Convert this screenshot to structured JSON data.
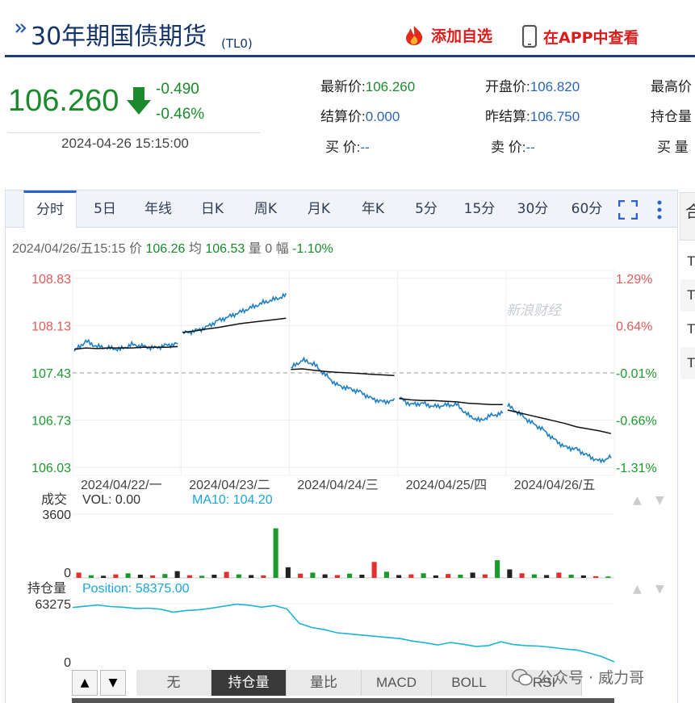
{
  "header": {
    "title": "30年期国债期货",
    "code": "(TL0)",
    "add_watchlist": "添加自选",
    "open_in_app": "在APP中查看"
  },
  "quote": {
    "price": "106.260",
    "change": "-0.490",
    "change_pct": "-0.46%",
    "time": "2024-04-26 15:15:00",
    "fields": {
      "latest": {
        "label": "最新价:",
        "value": "106.260"
      },
      "open": {
        "label": "开盘价:",
        "value": "106.820"
      },
      "high": {
        "label": "最高价"
      },
      "settle": {
        "label": "结算价:",
        "value": "0.000"
      },
      "prev_settle": {
        "label": "昨结算:",
        "value": "106.750"
      },
      "open_interest": {
        "label": "持仓量"
      },
      "bid": {
        "label": "买  价:",
        "value": "--"
      },
      "ask": {
        "label": "卖  价:",
        "value": "--"
      },
      "bid_vol": {
        "label": "买  量"
      }
    },
    "colors": {
      "down": "#1b8a2c",
      "up": "#e03030",
      "link": "#2a66b5"
    }
  },
  "tabs": [
    "分时",
    "5日",
    "年线",
    "日K",
    "周K",
    "月K",
    "年K",
    "5分",
    "15分",
    "30分",
    "60分"
  ],
  "infobar": {
    "datetime": "2024/04/26/五15:15",
    "price_label": "价",
    "price": "106.26",
    "avg_label": "均",
    "avg": "106.53",
    "vol_label": "量",
    "vol": "0",
    "amp_label": "幅",
    "amp": "-1.10%"
  },
  "chart_data": [
    {
      "type": "line",
      "title": "",
      "x": [
        "2024/04/22/一",
        "2024/04/23/二",
        "2024/04/24/三",
        "2024/04/25/四",
        "2024/04/26/五"
      ],
      "y_ticks_left": [
        "108.83",
        "108.13",
        "107.43",
        "106.73",
        "106.03"
      ],
      "y_ticks_right": [
        "1.29%",
        "0.64%",
        "-0.01%",
        "-0.66%",
        "-1.31%"
      ],
      "ylim": [
        106.03,
        108.83
      ],
      "prev_settle_line": 107.43,
      "watermark": "新浪财经",
      "series": [
        {
          "name": "价",
          "segments": [
            [
              107.75,
              107.9,
              107.82,
              107.8,
              107.78,
              107.85,
              107.82,
              107.8,
              107.84,
              107.86
            ],
            [
              108.02,
              108.05,
              108.1,
              108.2,
              108.26,
              108.33,
              108.4,
              108.47,
              108.52,
              108.58
            ],
            [
              107.5,
              107.62,
              107.56,
              107.4,
              107.25,
              107.2,
              107.15,
              107.05,
              107.0,
              107.02
            ],
            [
              107.06,
              106.96,
              106.98,
              106.93,
              106.95,
              106.96,
              106.8,
              106.72,
              106.8,
              106.83
            ],
            [
              106.95,
              106.83,
              106.7,
              106.6,
              106.45,
              106.33,
              106.3,
              106.2,
              106.12,
              106.18
            ]
          ]
        },
        {
          "name": "均",
          "segments": [
            [
              107.78,
              107.8,
              107.79,
              107.8,
              107.8,
              107.8,
              107.81,
              107.81,
              107.81,
              107.82
            ],
            [
              108.03,
              108.05,
              108.08,
              108.1,
              108.13,
              108.16,
              108.18,
              108.2,
              108.22,
              108.24
            ],
            [
              107.48,
              107.49,
              107.47,
              107.45,
              107.44,
              107.43,
              107.42,
              107.41,
              107.4,
              107.39
            ],
            [
              107.05,
              107.03,
              107.02,
              107.02,
              107.01,
              107.0,
              106.98,
              106.97,
              106.96,
              106.96
            ],
            [
              106.88,
              106.84,
              106.8,
              106.76,
              106.72,
              106.68,
              106.63,
              106.6,
              106.57,
              106.53
            ]
          ]
        }
      ]
    },
    {
      "type": "bar",
      "title": "成交",
      "legend": [
        "VOL: 0.00",
        "MA10: 104.20"
      ],
      "y_ticks": [
        "3600",
        "0"
      ],
      "ylim": [
        0,
        3600
      ],
      "values": [
        300,
        150,
        120,
        200,
        260,
        180,
        140,
        220,
        380,
        150,
        120,
        180,
        340,
        200,
        160,
        140,
        2800,
        600,
        240,
        300,
        200,
        160,
        240,
        180,
        900,
        350,
        160,
        200,
        260,
        140,
        220,
        180,
        300,
        200,
        1000,
        480,
        260,
        200,
        160,
        300,
        180,
        140,
        100,
        80
      ]
    },
    {
      "type": "line",
      "title": "持仓量",
      "legend": [
        "Position: 58375.00"
      ],
      "y_ticks": [
        "63275",
        "0"
      ],
      "ylim": [
        0,
        63275
      ],
      "values": [
        61000,
        61800,
        62500,
        61600,
        61200,
        60400,
        60600,
        60000,
        58200,
        59200,
        59600,
        60600,
        61800,
        63000,
        62400,
        61200,
        62200,
        60200,
        51500,
        49000,
        47700,
        45900,
        45200,
        44500,
        43800,
        43100,
        42400,
        40900,
        39900,
        38600,
        40100,
        39000,
        37700,
        38200,
        40500,
        38800,
        38200,
        37900,
        37200,
        36200,
        35600,
        33800,
        31600,
        28500
      ]
    }
  ],
  "indicator_tabs": [
    "无",
    "持仓量",
    "量比",
    "MACD",
    "BOLL",
    "RSI"
  ],
  "indicator_active": "持仓量",
  "side_panel": [
    "T",
    "T",
    "T",
    "T"
  ],
  "watermark_text": "公众号 · 威力哥"
}
